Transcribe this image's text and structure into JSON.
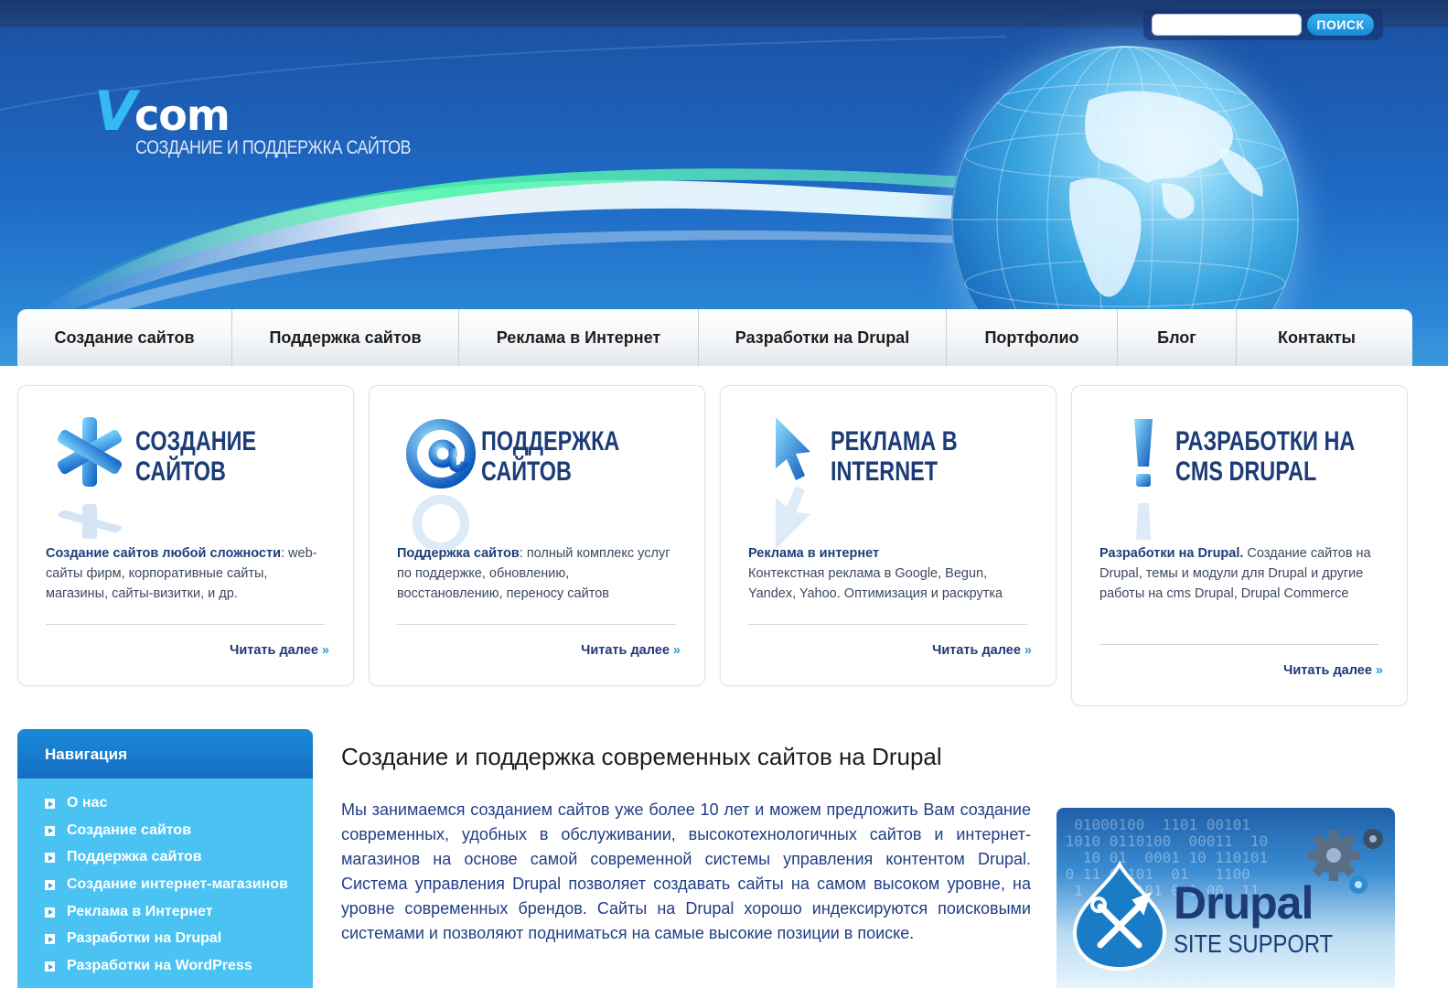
{
  "header": {
    "logo_v": "V",
    "logo_com": "com",
    "logo_tagline": "СОЗДАНИЕ И ПОДДЕРЖКА САЙТОВ",
    "search_placeholder": "",
    "search_button": "ПОИСК"
  },
  "menu": [
    {
      "label": "Создание сайтов"
    },
    {
      "label": "Поддержка сайтов"
    },
    {
      "label": "Реклама в Интернет"
    },
    {
      "label": "Разработки на Drupal"
    },
    {
      "label": "Портфолио"
    },
    {
      "label": "Блог"
    },
    {
      "label": "Контакты"
    }
  ],
  "features": [
    {
      "icon": "asterisk-icon",
      "title_line1": "Создание",
      "title_line2": "сайтов",
      "text_bold": "Создание сайтов любой сложности",
      "text_rest": ": web-сайты фирм, корпоративные сайты, магазины, сайты-визитки, и др.",
      "more": "Читать далее"
    },
    {
      "icon": "at-sign-icon",
      "title_line1": "Поддержка",
      "title_line2": "сайтов",
      "text_bold": "Поддержка сайтов",
      "text_rest": ": полный комплекс услуг по поддержке, обновлению, восстановлению, переносу сайтов",
      "more": "Читать далее"
    },
    {
      "icon": "cursor-arrow-icon",
      "title_line1": "Реклама в",
      "title_line2": "Internet",
      "text_bold": "Реклама в интернет",
      "text_rest": " Контекстная реклама в Google, Begun, Yandex, Yahoo. Оптимизация и раскрутка",
      "more": "Читать далее"
    },
    {
      "icon": "exclamation-icon",
      "title_line1": "Разработки на",
      "title_line2": "CMS Drupal",
      "text_bold": "Разработки на Drupal.",
      "text_rest": " Создание сайтов на Drupal, темы и модули для Drupal и другие работы на cms Drupal, Drupal Commerce",
      "more": "Читать далее"
    }
  ],
  "sidebar": {
    "title": "Навигация",
    "items": [
      {
        "label": "О нас"
      },
      {
        "label": "Создание сайтов"
      },
      {
        "label": "Поддержка сайтов"
      },
      {
        "label": "Создание интернет-магазинов"
      },
      {
        "label": "Реклама в Интернет"
      },
      {
        "label": "Разработки на Drupal"
      },
      {
        "label": "Разработки на WordPress"
      }
    ]
  },
  "main": {
    "title": "Создание и поддержка современных сайтов на Drupal",
    "text": "Мы занимаемся созданием сайтов уже более 10 лет и можем предложить Вам создание современных, удобных в обслуживании, высокотехнологичных сайтов и интернет-магазинов на основе самой современной системы управления контентом Drupal. Система управления Drupal позволяет создавать сайты на самом высоком уровне, на уровне современных брендов. Сайты на Drupal хорошо индексируются поисковыми системами и позволяют подниматься на самые высокие позиции в поиске.",
    "banner_word": "Drupal",
    "banner_sub": "SITE SUPPORT"
  },
  "colors": {
    "header_blue": "#1d5cb2",
    "title_navy": "#1c3c78",
    "sidebar_cyan": "#4ac3f3",
    "link_blue": "#2d9ad8"
  }
}
